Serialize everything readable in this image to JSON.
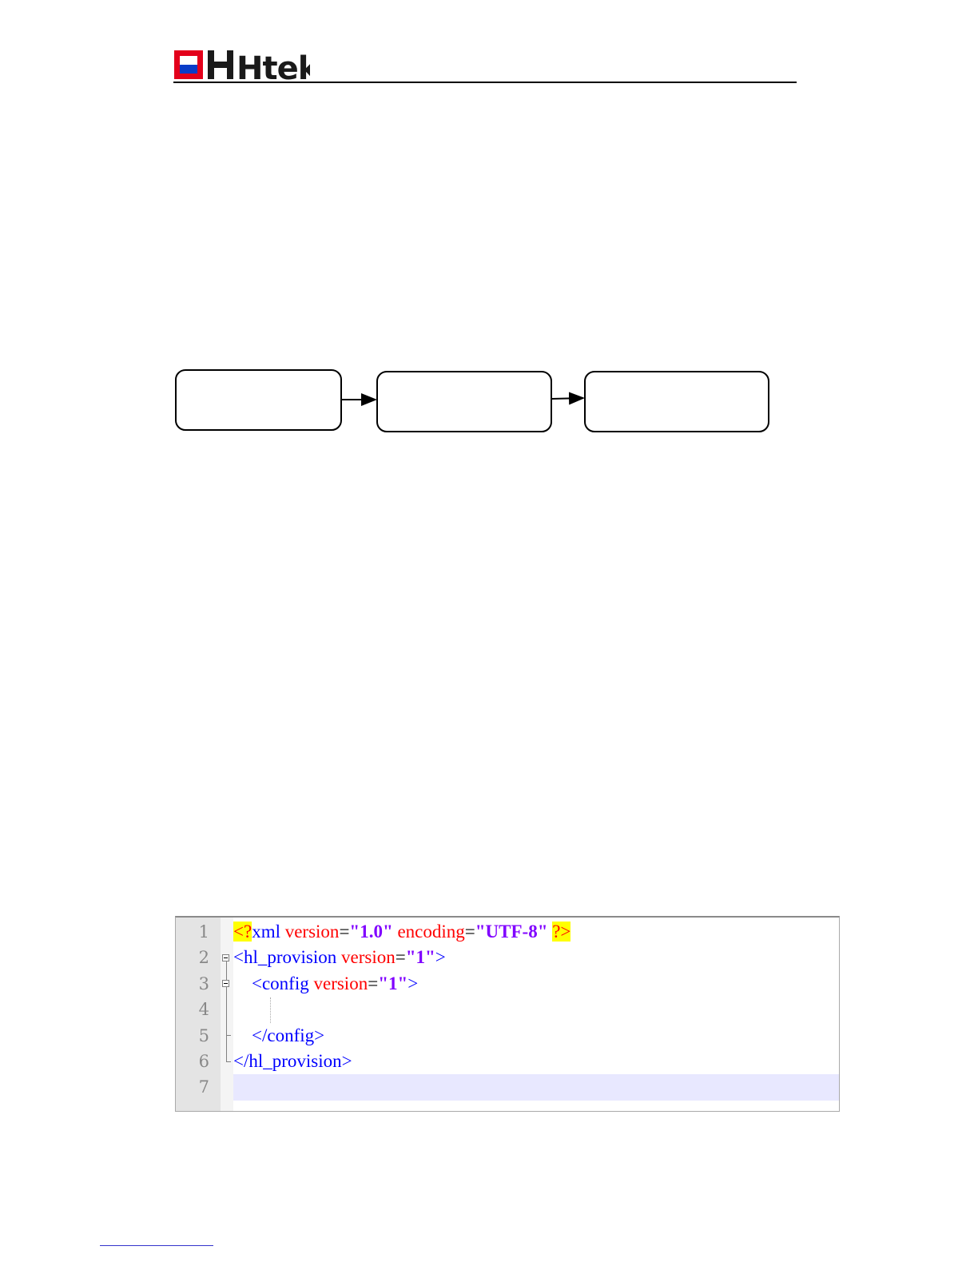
{
  "header": {
    "logo_text": "Htek",
    "colors": {
      "red": "#e3001b",
      "blue": "#0a3cc8",
      "black": "#1a1a1a"
    }
  },
  "flow_diagram": {
    "boxes": [
      {
        "id": "step-1",
        "label": ""
      },
      {
        "id": "step-2",
        "label": ""
      },
      {
        "id": "step-3",
        "label": ""
      }
    ],
    "connectors": [
      {
        "from": "step-1",
        "to": "step-2"
      },
      {
        "from": "step-2",
        "to": "step-3"
      }
    ]
  },
  "code_editor": {
    "line_numbers": [
      "1",
      "2",
      "3",
      "4",
      "5",
      "6",
      "7"
    ],
    "lines": [
      [
        {
          "t": "pi",
          "v": "<?"
        },
        {
          "t": "tag",
          "v": "xml "
        },
        {
          "t": "attr",
          "v": "version"
        },
        {
          "t": "plain",
          "v": "="
        },
        {
          "t": "val",
          "v": "\"1.0\""
        },
        {
          "t": "plain",
          "v": " "
        },
        {
          "t": "attr",
          "v": "encoding"
        },
        {
          "t": "plain",
          "v": "="
        },
        {
          "t": "val",
          "v": "\"UTF-8\""
        },
        {
          "t": "plain",
          "v": " "
        },
        {
          "t": "pi",
          "v": "?>"
        }
      ],
      [
        {
          "t": "tag",
          "v": "<hl_provision "
        },
        {
          "t": "attr",
          "v": "version"
        },
        {
          "t": "plain",
          "v": "="
        },
        {
          "t": "val",
          "v": "\"1\""
        },
        {
          "t": "tag",
          "v": ">"
        }
      ],
      [
        {
          "t": "plain",
          "v": "    "
        },
        {
          "t": "tag",
          "v": "<config "
        },
        {
          "t": "attr",
          "v": "version"
        },
        {
          "t": "plain",
          "v": "="
        },
        {
          "t": "val",
          "v": "\"1\""
        },
        {
          "t": "tag",
          "v": ">"
        }
      ],
      [],
      [
        {
          "t": "plain",
          "v": "    "
        },
        {
          "t": "tag",
          "v": "</config>"
        }
      ],
      [
        {
          "t": "tag",
          "v": "</hl_provision>"
        }
      ],
      []
    ],
    "current_line": 7,
    "colors": {
      "tag": "#0000ff",
      "attr": "#ff0000",
      "value": "#8000ff",
      "pi_highlight": "#ffff00",
      "current_line_bg": "#e8e8ff"
    }
  }
}
